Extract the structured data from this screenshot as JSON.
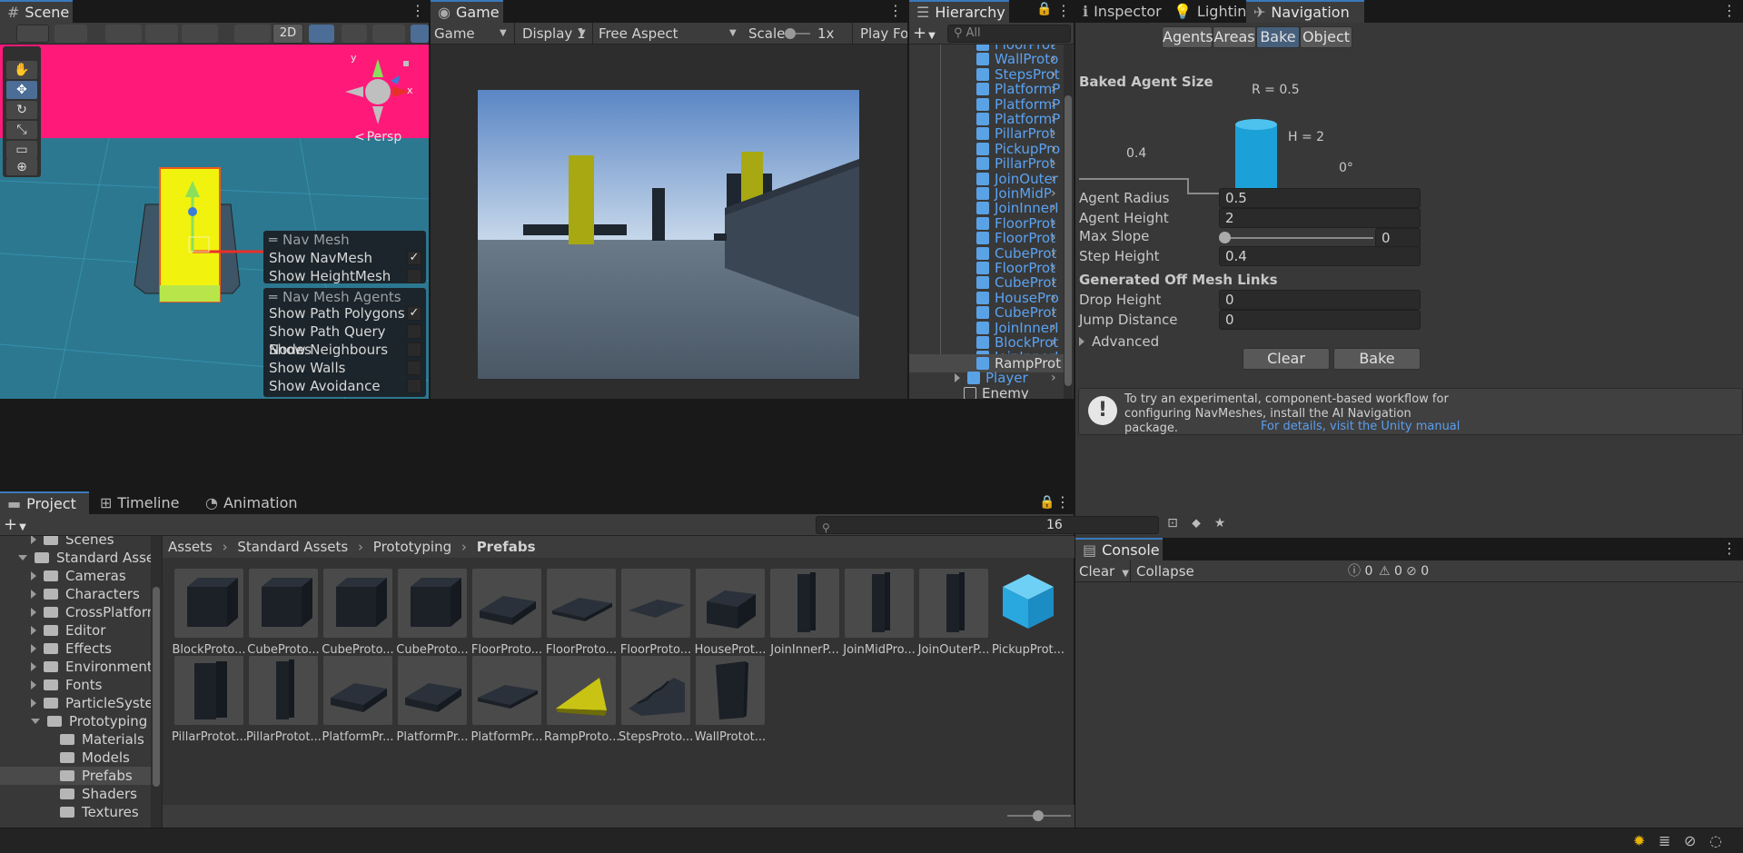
{
  "tabs": {
    "scene": "Scene",
    "game": "Game",
    "hierarchy": "Hierarchy",
    "inspector": "Inspector",
    "lighting": "Lighting",
    "navigation": "Navigation",
    "project": "Project",
    "timeline": "Timeline",
    "animation": "Animation",
    "console": "Console"
  },
  "scene": {
    "btn_2d": "2D",
    "persp": "Persp",
    "gizmo_y": "y",
    "gizmo_x": "x",
    "navmesh_overlay": {
      "title": "Nav Mesh",
      "items": [
        {
          "label": "Show NavMesh",
          "checked": true
        },
        {
          "label": "Show HeightMesh",
          "checked": false
        }
      ]
    },
    "agents_overlay": {
      "title": "Nav Mesh Agents",
      "items": [
        {
          "label": "Show Path Polygons",
          "checked": true
        },
        {
          "label": "Show Path Query Nodes",
          "checked": false
        },
        {
          "label": "Show Neighbours",
          "checked": false
        },
        {
          "label": "Show Walls",
          "checked": false
        },
        {
          "label": "Show Avoidance",
          "checked": false
        }
      ]
    }
  },
  "game": {
    "mode": "Game",
    "display": "Display 1",
    "aspect": "Free Aspect",
    "scale_label": "Scale",
    "scale_value": "1x",
    "play_focused": "Play Foc"
  },
  "hierarchy": {
    "search_placeholder": "All",
    "items": [
      "FloorProt",
      "WallProto",
      "StepsProt",
      "PlatformP",
      "PlatformP",
      "PlatformP",
      "PillarProt",
      "PickupPro",
      "PillarProt",
      "JoinOuter",
      "JoinMidP",
      "JoinInnerI",
      "FloorProt",
      "FloorProt",
      "CubeProt",
      "FloorProt",
      "CubeProt",
      "HousePro",
      "CubeProt",
      "JoinInnerI",
      "BlockProt",
      "JoinInnerI",
      "RampProt"
    ],
    "player": "Player",
    "enemy": "Enemy"
  },
  "navigation": {
    "subtabs": [
      "Agents",
      "Areas",
      "Bake",
      "Object"
    ],
    "active_subtab": "Bake",
    "baked_agent_size": "Baked Agent Size",
    "diagram": {
      "r_label": "R = 0.5",
      "h_label": "H = 2",
      "step_label": "0.4",
      "slope_label": "0°"
    },
    "fields": [
      {
        "label": "Agent Radius",
        "value": "0.5"
      },
      {
        "label": "Agent Height",
        "value": "2"
      },
      {
        "label": "Max Slope",
        "value": "0",
        "slider": 0
      },
      {
        "label": "Step Height",
        "value": "0.4"
      }
    ],
    "offmesh_header": "Generated Off Mesh Links",
    "offmesh_fields": [
      {
        "label": "Drop Height",
        "value": "0"
      },
      {
        "label": "Jump Distance",
        "value": "0"
      }
    ],
    "advanced": "Advanced",
    "clear_btn": "Clear",
    "bake_btn": "Bake",
    "info_text": "To try an experimental, component-based workflow for configuring NavMeshes, install the AI Navigation package.",
    "info_link": "For details, visit the Unity manual"
  },
  "project": {
    "hidden_count": "16",
    "tree": [
      {
        "label": "Scenes",
        "depth": 1,
        "expand": "right"
      },
      {
        "label": "Standard Assets",
        "depth": 0,
        "expand": "down"
      },
      {
        "label": "Cameras",
        "depth": 1,
        "expand": "right"
      },
      {
        "label": "Characters",
        "depth": 1,
        "expand": "right"
      },
      {
        "label": "CrossPlatformInp",
        "depth": 1,
        "expand": "right"
      },
      {
        "label": "Editor",
        "depth": 1,
        "expand": "right"
      },
      {
        "label": "Effects",
        "depth": 1,
        "expand": "right"
      },
      {
        "label": "Environment",
        "depth": 1,
        "expand": "right"
      },
      {
        "label": "Fonts",
        "depth": 1,
        "expand": "right"
      },
      {
        "label": "ParticleSystems",
        "depth": 1,
        "expand": "right"
      },
      {
        "label": "Prototyping",
        "depth": 1,
        "expand": "down"
      },
      {
        "label": "Materials",
        "depth": 2,
        "expand": "none"
      },
      {
        "label": "Models",
        "depth": 2,
        "expand": "none"
      },
      {
        "label": "Prefabs",
        "depth": 2,
        "expand": "none",
        "selected": true
      },
      {
        "label": "Shaders",
        "depth": 2,
        "expand": "none"
      },
      {
        "label": "Textures",
        "depth": 2,
        "expand": "none"
      }
    ],
    "breadcrumb": [
      "Assets",
      "Standard Assets",
      "Prototyping",
      "Prefabs"
    ],
    "assets": [
      {
        "label": "BlockProto...",
        "shape": "cube"
      },
      {
        "label": "CubeProto...",
        "shape": "cube"
      },
      {
        "label": "CubeProto...",
        "shape": "cube"
      },
      {
        "label": "CubeProto...",
        "shape": "cube"
      },
      {
        "label": "FloorProto...",
        "shape": "slab"
      },
      {
        "label": "FloorProto...",
        "shape": "slab-thin"
      },
      {
        "label": "FloorProto...",
        "shape": "plane"
      },
      {
        "label": "HouseProt...",
        "shape": "house"
      },
      {
        "label": "JoinInnerP...",
        "shape": "pillar"
      },
      {
        "label": "JoinMidPro...",
        "shape": "pillar"
      },
      {
        "label": "JoinOuterP...",
        "shape": "pillar"
      },
      {
        "label": "PickupProt...",
        "shape": "pickup"
      },
      {
        "label": "PillarProtot...",
        "shape": "pillar-wide"
      },
      {
        "label": "PillarProtot...",
        "shape": "pillar"
      },
      {
        "label": "PlatformPr...",
        "shape": "slab"
      },
      {
        "label": "PlatformPr...",
        "shape": "slab"
      },
      {
        "label": "PlatformPr...",
        "shape": "slab-thin"
      },
      {
        "label": "RampProto...",
        "shape": "ramp"
      },
      {
        "label": "StepsProto...",
        "shape": "steps"
      },
      {
        "label": "WallProtot...",
        "shape": "wall"
      }
    ]
  },
  "console": {
    "clear": "Clear",
    "collapse": "Collapse",
    "info_count": "0",
    "warn_count": "0",
    "error_count": "0"
  },
  "colors": {
    "accent": "#3a79bb",
    "hierarchy_text": "#5aa2f2",
    "pickup": "#29a8e0",
    "yellow": "#f2f20f",
    "magenta": "#ff1a7a"
  }
}
